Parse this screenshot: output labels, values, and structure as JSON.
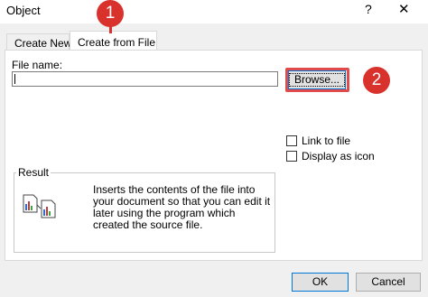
{
  "window": {
    "title": "Object",
    "help_glyph": "?",
    "close_glyph": "✕"
  },
  "tabs": [
    {
      "label": "Create New",
      "active": false
    },
    {
      "label": "Create from File",
      "active": true
    }
  ],
  "file": {
    "label": "File name:",
    "value": "",
    "browse_label": "Browse..."
  },
  "options": {
    "link_label": "Link to file",
    "link_checked": false,
    "icon_label": "Display as icon",
    "icon_checked": false
  },
  "result": {
    "label": "Result",
    "text": "Inserts the contents of the file into your document so that you can edit it later using the program which created the source file."
  },
  "buttons": {
    "ok": "OK",
    "cancel": "Cancel"
  },
  "annotations": {
    "badge1": "1",
    "badge2": "2",
    "accent": "#d9312b"
  }
}
